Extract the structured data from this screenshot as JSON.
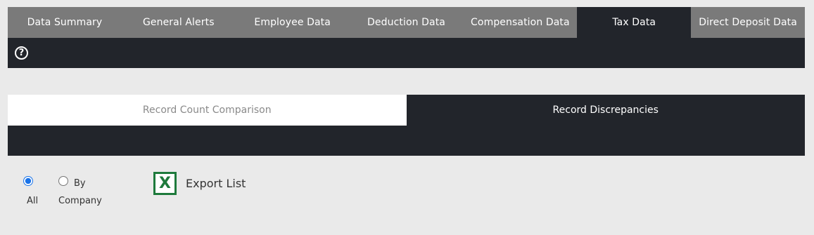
{
  "top_tabs": [
    {
      "label": "Data Summary",
      "active": false
    },
    {
      "label": "General Alerts",
      "active": false
    },
    {
      "label": "Employee Data",
      "active": false
    },
    {
      "label": "Deduction Data",
      "active": false
    },
    {
      "label": "Compensation Data",
      "active": false
    },
    {
      "label": "Tax Data",
      "active": true
    },
    {
      "label": "Direct Deposit Data",
      "active": false
    }
  ],
  "help_icon": {
    "glyph": "?",
    "icon": "help-circle-icon"
  },
  "sub_tabs": [
    {
      "label": "Record Count Comparison",
      "active": false
    },
    {
      "label": "Record Discrepancies",
      "active": true
    }
  ],
  "filter": {
    "selected": "all",
    "all_label": "All",
    "by_company_label_1": "By",
    "by_company_label_2": "Company"
  },
  "export": {
    "label": "Export List",
    "icon": "excel-icon",
    "icon_glyph": "X"
  },
  "colors": {
    "background": "#eaeaea",
    "dark_bar": "#22252b",
    "tab_gray": "#7a7a7a",
    "excel_green": "#1e7a3c"
  }
}
